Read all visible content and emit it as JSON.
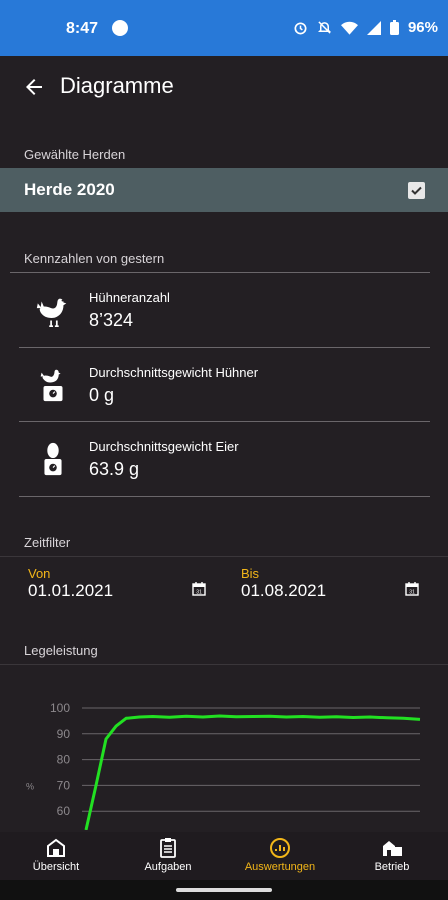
{
  "status": {
    "time": "8:47",
    "battery": "96%"
  },
  "appbar": {
    "title": "Diagramme"
  },
  "herds": {
    "section_label": "Gewählte Herden",
    "selected": "Herde 2020"
  },
  "kpis": {
    "section_label": "Kennzahlen von gestern",
    "items": [
      {
        "label": "Hühneranzahl",
        "value": "8’324",
        "icon": "chicken-icon"
      },
      {
        "label": "Durchschnittsgewicht Hühner",
        "value": "0 g",
        "icon": "chicken-scale-icon"
      },
      {
        "label": "Durchschnittsgewicht Eier",
        "value": "63.9 g",
        "icon": "egg-scale-icon"
      }
    ]
  },
  "timefilter": {
    "section_label": "Zeitfilter",
    "from_label": "Von",
    "from_value": "01.01.2021",
    "to_label": "Bis",
    "to_value": "01.08.2021"
  },
  "legeleistung": {
    "section_label": "Legeleistung"
  },
  "chart_data": {
    "type": "line",
    "title": "Legeleistung",
    "ylabel": "%",
    "ylim": [
      50,
      100
    ],
    "yticks": [
      60,
      70,
      80,
      90,
      100
    ],
    "series": [
      {
        "color": "#22e022",
        "x": [
          0,
          0.03,
          0.06,
          0.09,
          0.12,
          0.16,
          0.2,
          0.25,
          0.3,
          0.35,
          0.4,
          0.45,
          0.5,
          0.55,
          0.6,
          0.65,
          0.7,
          0.75,
          0.8,
          0.85,
          0.9,
          0.95,
          1.0
        ],
        "y": [
          51,
          70,
          88,
          93,
          96,
          96.5,
          96.7,
          96.4,
          96.8,
          96.5,
          96.9,
          96.6,
          96.7,
          96.8,
          96.5,
          96.7,
          96.4,
          96.6,
          96.3,
          96.5,
          96.2,
          96.0,
          95.6
        ]
      }
    ]
  },
  "nav": {
    "items": [
      {
        "label": "Übersicht",
        "active": false
      },
      {
        "label": "Aufgaben",
        "active": false
      },
      {
        "label": "Auswertungen",
        "active": true
      },
      {
        "label": "Betrieb",
        "active": false
      }
    ]
  },
  "colors": {
    "accent": "#f2b619",
    "status_bar": "#2879d8",
    "line": "#22e022"
  }
}
